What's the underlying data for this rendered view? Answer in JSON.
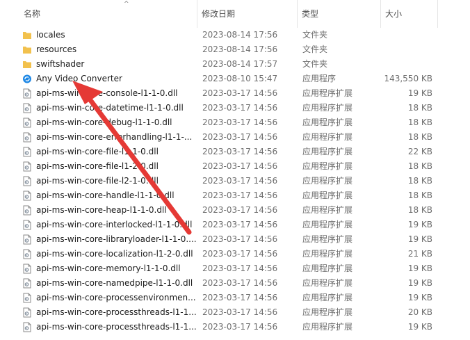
{
  "columns": {
    "name": "名称",
    "date": "修改日期",
    "type": "类型",
    "size": "大小"
  },
  "sort_indicator": "^",
  "files": [
    {
      "name": "locales",
      "date": "2023-08-14 17:56",
      "type": "文件夹",
      "size": "",
      "icon": "folder-icon"
    },
    {
      "name": "resources",
      "date": "2023-08-14 17:56",
      "type": "文件夹",
      "size": "",
      "icon": "folder-icon"
    },
    {
      "name": "swiftshader",
      "date": "2023-08-14 17:57",
      "type": "文件夹",
      "size": "",
      "icon": "folder-icon"
    },
    {
      "name": "Any Video Converter",
      "date": "2023-08-10 15:47",
      "type": "应用程序",
      "size": "143,550 KB",
      "icon": "app-icon"
    },
    {
      "name": "api-ms-win-core-console-l1-1-0.dll",
      "date": "2023-03-17 14:56",
      "type": "应用程序扩展",
      "size": "19 KB",
      "icon": "dll-icon"
    },
    {
      "name": "api-ms-win-core-datetime-l1-1-0.dll",
      "date": "2023-03-17 14:56",
      "type": "应用程序扩展",
      "size": "18 KB",
      "icon": "dll-icon"
    },
    {
      "name": "api-ms-win-core-debug-l1-1-0.dll",
      "date": "2023-03-17 14:56",
      "type": "应用程序扩展",
      "size": "18 KB",
      "icon": "dll-icon"
    },
    {
      "name": "api-ms-win-core-errorhandling-l1-1-...",
      "date": "2023-03-17 14:56",
      "type": "应用程序扩展",
      "size": "18 KB",
      "icon": "dll-icon"
    },
    {
      "name": "api-ms-win-core-file-l1-1-0.dll",
      "date": "2023-03-17 14:56",
      "type": "应用程序扩展",
      "size": "22 KB",
      "icon": "dll-icon"
    },
    {
      "name": "api-ms-win-core-file-l1-2-0.dll",
      "date": "2023-03-17 14:56",
      "type": "应用程序扩展",
      "size": "18 KB",
      "icon": "dll-icon"
    },
    {
      "name": "api-ms-win-core-file-l2-1-0.dll",
      "date": "2023-03-17 14:56",
      "type": "应用程序扩展",
      "size": "18 KB",
      "icon": "dll-icon"
    },
    {
      "name": "api-ms-win-core-handle-l1-1-0.dll",
      "date": "2023-03-17 14:56",
      "type": "应用程序扩展",
      "size": "18 KB",
      "icon": "dll-icon"
    },
    {
      "name": "api-ms-win-core-heap-l1-1-0.dll",
      "date": "2023-03-17 14:56",
      "type": "应用程序扩展",
      "size": "18 KB",
      "icon": "dll-icon"
    },
    {
      "name": "api-ms-win-core-interlocked-l1-1-0.dll",
      "date": "2023-03-17 14:56",
      "type": "应用程序扩展",
      "size": "19 KB",
      "icon": "dll-icon"
    },
    {
      "name": "api-ms-win-core-libraryloader-l1-1-0....",
      "date": "2023-03-17 14:56",
      "type": "应用程序扩展",
      "size": "19 KB",
      "icon": "dll-icon"
    },
    {
      "name": "api-ms-win-core-localization-l1-2-0.dll",
      "date": "2023-03-17 14:56",
      "type": "应用程序扩展",
      "size": "21 KB",
      "icon": "dll-icon"
    },
    {
      "name": "api-ms-win-core-memory-l1-1-0.dll",
      "date": "2023-03-17 14:56",
      "type": "应用程序扩展",
      "size": "19 KB",
      "icon": "dll-icon"
    },
    {
      "name": "api-ms-win-core-namedpipe-l1-1-0.dll",
      "date": "2023-03-17 14:56",
      "type": "应用程序扩展",
      "size": "19 KB",
      "icon": "dll-icon"
    },
    {
      "name": "api-ms-win-core-processenvironmen...",
      "date": "2023-03-17 14:56",
      "type": "应用程序扩展",
      "size": "19 KB",
      "icon": "dll-icon"
    },
    {
      "name": "api-ms-win-core-processthreads-l1-1...",
      "date": "2023-03-17 14:56",
      "type": "应用程序扩展",
      "size": "20 KB",
      "icon": "dll-icon"
    },
    {
      "name": "api-ms-win-core-processthreads-l1-1...",
      "date": "2023-03-17 14:56",
      "type": "应用程序扩展",
      "size": "19 KB",
      "icon": "dll-icon"
    }
  ],
  "colors": {
    "folder": "#f2c14e",
    "app": "#1e88e5",
    "arrow": "#e53935"
  }
}
